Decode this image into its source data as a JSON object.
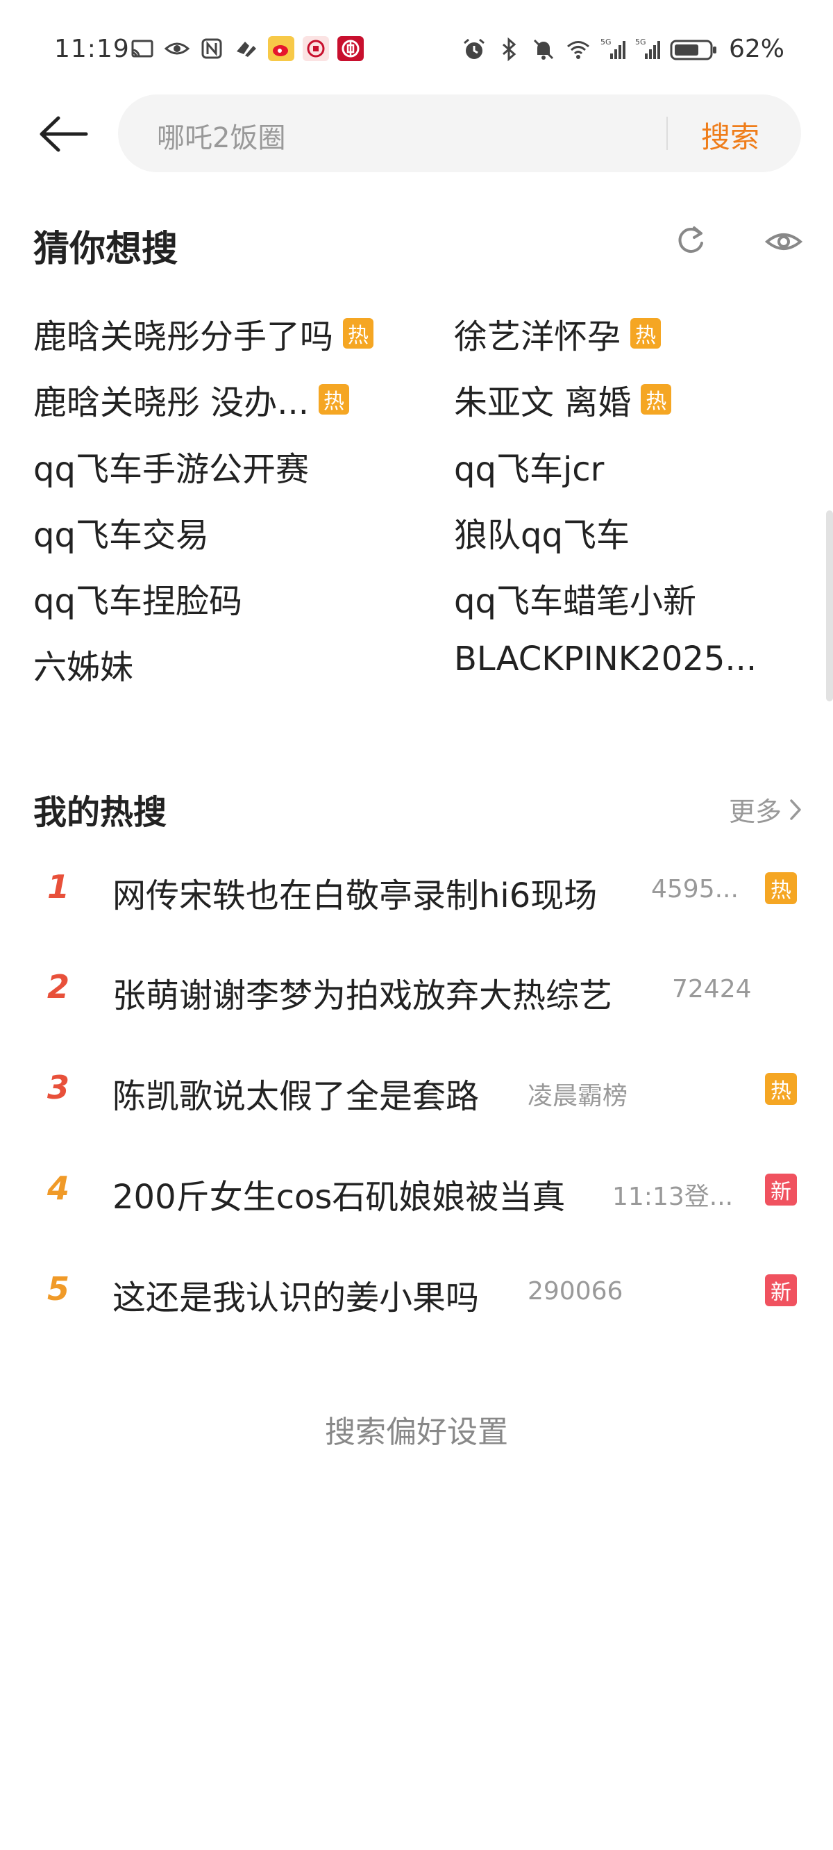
{
  "status_bar": {
    "time": "11:19",
    "battery": "62%",
    "net_5g_1": "5G",
    "net_5g_2": "5G"
  },
  "search": {
    "placeholder": "哪吒2饭圈",
    "submit_label": "搜索"
  },
  "guess": {
    "title": "猜你想搜",
    "items": [
      {
        "text": "鹿晗关晓彤分手了吗",
        "tag": "热"
      },
      {
        "text": "徐艺洋怀孕",
        "tag": "热"
      },
      {
        "text": "鹿晗关晓彤 没办...",
        "tag": "热"
      },
      {
        "text": "朱亚文 离婚",
        "tag": "热"
      },
      {
        "text": "qq飞车手游公开赛",
        "tag": ""
      },
      {
        "text": "qq飞车jcr",
        "tag": ""
      },
      {
        "text": "qq飞车交易",
        "tag": ""
      },
      {
        "text": "狼队qq飞车",
        "tag": ""
      },
      {
        "text": "qq飞车捏脸码",
        "tag": ""
      },
      {
        "text": "qq飞车蜡笔小新",
        "tag": ""
      },
      {
        "text": "六姊妹",
        "tag": ""
      },
      {
        "text": "BLACKPINK2025...",
        "tag": ""
      }
    ]
  },
  "hot": {
    "title": "我的热搜",
    "more_label": "更多",
    "items": [
      {
        "rank": "1",
        "text": "网传宋轶也在白敬亭录制hi6现场",
        "meta": "4595...",
        "tag": "热",
        "tag_color": "#f5a623",
        "rank_color": "#e8503a"
      },
      {
        "rank": "2",
        "text": "张萌谢谢李梦为拍戏放弃大热综艺",
        "meta": "72424",
        "tag": "",
        "tag_color": "",
        "rank_color": "#e8503a"
      },
      {
        "rank": "3",
        "text": "陈凯歌说太假了全是套路",
        "meta": "凌晨霸榜",
        "tag": "热",
        "tag_color": "#f5a623",
        "rank_color": "#e8503a"
      },
      {
        "rank": "4",
        "text": "200斤女生cos石矶娘娘被当真",
        "meta": "11:13登...",
        "tag": "新",
        "tag_color": "#f0525f",
        "rank_color": "#f09a28"
      },
      {
        "rank": "5",
        "text": "这还是我认识的姜小果吗",
        "meta": "290066",
        "tag": "新",
        "tag_color": "#f0525f",
        "rank_color": "#f09a28"
      }
    ]
  },
  "preferences_label": "搜索偏好设置"
}
